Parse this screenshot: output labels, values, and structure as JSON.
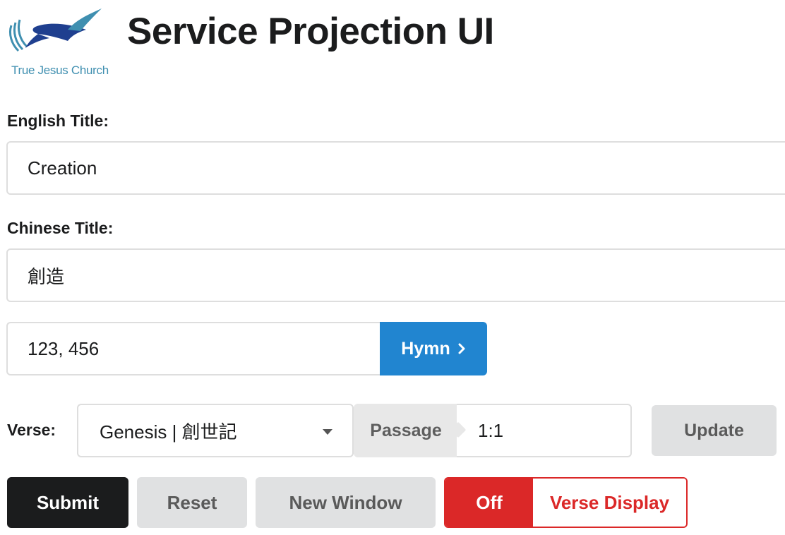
{
  "header": {
    "logo_text": "True Jesus Church",
    "title": "Service Projection UI"
  },
  "english_title": {
    "label": "English Title:",
    "value": "Creation"
  },
  "chinese_title": {
    "label": "Chinese Title:",
    "value": "創造"
  },
  "hymn": {
    "value": "123, 456",
    "button_label": "Hymn",
    "button_icon": "chevron-right-icon"
  },
  "verse": {
    "label": "Verse:",
    "book_selected": "Genesis | 創世記",
    "passage_label": "Passage",
    "passage_value": "1:1",
    "update_label": "Update"
  },
  "actions": {
    "submit_label": "Submit",
    "reset_label": "Reset",
    "new_window_label": "New Window",
    "toggle_state_label": "Off",
    "toggle_label": "Verse Display"
  },
  "colors": {
    "primary": "#2185d0",
    "submit": "#1b1c1d",
    "danger": "#db2828",
    "secondary_bg": "#e0e1e2",
    "logo_blue": "#1f3f8f",
    "logo_teal": "#3f8fb0"
  }
}
